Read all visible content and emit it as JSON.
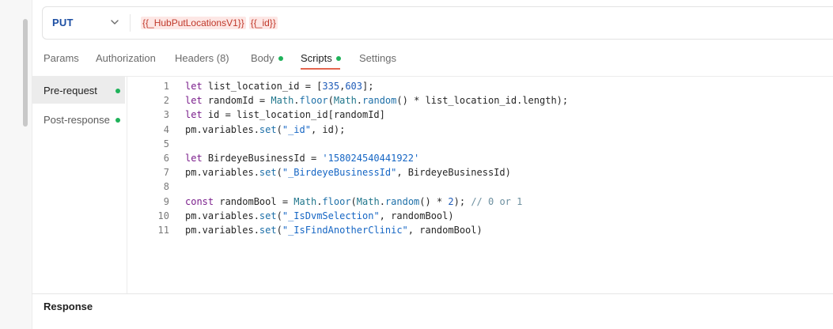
{
  "request": {
    "method": "PUT",
    "url_parts": [
      "{{_HubPutLocationsV1}}",
      "{{_id}}"
    ]
  },
  "tabs": [
    {
      "label": "Params",
      "active": false,
      "dot": false
    },
    {
      "label": "Authorization",
      "active": false,
      "dot": false
    },
    {
      "label": "Headers (8)",
      "active": false,
      "dot": false
    },
    {
      "label": "Body",
      "active": false,
      "dot": true
    },
    {
      "label": "Scripts",
      "active": true,
      "dot": true
    },
    {
      "label": "Settings",
      "active": false,
      "dot": false
    }
  ],
  "script_nav": [
    {
      "label": "Pre-request",
      "active": true
    },
    {
      "label": "Post-response",
      "active": false
    }
  ],
  "code": {
    "lines": [
      [
        [
          "kw",
          "let"
        ],
        [
          "",
          "list_location_id = ["
        ],
        [
          "num",
          "335"
        ],
        [
          "",
          ","
        ],
        [
          "num",
          "603"
        ],
        [
          "",
          "];"
        ]
      ],
      [
        [
          "kw",
          "let"
        ],
        [
          "",
          "randomId = "
        ],
        [
          "obj",
          "Math"
        ],
        [
          "",
          "."
        ],
        [
          "mth",
          "floor"
        ],
        [
          "",
          "("
        ],
        [
          "obj",
          "Math"
        ],
        [
          "",
          "."
        ],
        [
          "mth",
          "random"
        ],
        [
          "",
          "() * list_location_id.length);"
        ]
      ],
      [
        [
          "kw",
          "let"
        ],
        [
          "",
          "id = list_location_id[randomId]"
        ]
      ],
      [
        [
          "",
          "pm.variables."
        ],
        [
          "mth",
          "set"
        ],
        [
          "",
          "("
        ],
        [
          "str",
          "\"_id\""
        ],
        [
          "",
          ", id);"
        ]
      ],
      [],
      [
        [
          "kw",
          "let"
        ],
        [
          "",
          "BirdeyeBusinessId = "
        ],
        [
          "str",
          "'158024540441922'"
        ]
      ],
      [
        [
          "",
          "pm.variables."
        ],
        [
          "mth",
          "set"
        ],
        [
          "",
          "("
        ],
        [
          "str",
          "\"_BirdeyeBusinessId\""
        ],
        [
          "",
          ", BirdeyeBusinessId)"
        ]
      ],
      [],
      [
        [
          "kw",
          "const"
        ],
        [
          "",
          "randomBool = "
        ],
        [
          "obj",
          "Math"
        ],
        [
          "",
          "."
        ],
        [
          "mth",
          "floor"
        ],
        [
          "",
          "("
        ],
        [
          "obj",
          "Math"
        ],
        [
          "",
          "."
        ],
        [
          "mth",
          "random"
        ],
        [
          "",
          "() * "
        ],
        [
          "num",
          "2"
        ],
        [
          "",
          "); "
        ],
        [
          "cmt",
          "// 0 or 1"
        ]
      ],
      [
        [
          "",
          "pm.variables."
        ],
        [
          "mth",
          "set"
        ],
        [
          "",
          "("
        ],
        [
          "str",
          "\"_IsDvmSelection\""
        ],
        [
          "",
          ", randomBool)"
        ]
      ],
      [
        [
          "",
          "pm.variables."
        ],
        [
          "mth",
          "set"
        ],
        [
          "",
          "("
        ],
        [
          "str",
          "\"_IsFindAnotherClinic\""
        ],
        [
          "",
          ", randomBool)"
        ]
      ]
    ]
  },
  "response": {
    "title": "Response"
  }
}
